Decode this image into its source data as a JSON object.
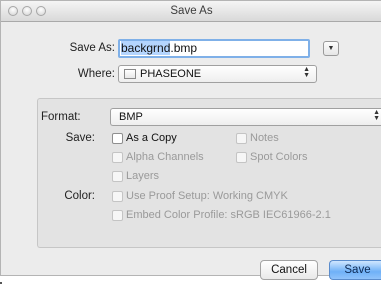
{
  "window": {
    "title": "Save As"
  },
  "form": {
    "save_as_label": "Save As:",
    "filename": "backgrnd.bmp",
    "filename_selected": "backgrnd",
    "filename_ext": ".bmp",
    "where_label": "Where:",
    "where_value": "PHASEONE"
  },
  "options": {
    "format_label": "Format:",
    "format_value": "BMP",
    "save_label": "Save:",
    "color_label": "Color:",
    "as_a_copy": {
      "label": "As a Copy",
      "enabled": true,
      "checked": false
    },
    "notes": {
      "label": "Notes",
      "enabled": false,
      "checked": false
    },
    "alpha_channels": {
      "label": "Alpha Channels",
      "enabled": false,
      "checked": false
    },
    "spot_colors": {
      "label": "Spot Colors",
      "enabled": false,
      "checked": false
    },
    "layers": {
      "label": "Layers",
      "enabled": false,
      "checked": false
    },
    "proof_setup": {
      "label": "Use Proof Setup:  Working CMYK",
      "enabled": false,
      "checked": false
    },
    "embed_profile": {
      "label": "Embed Color Profile:  sRGB IEC61966-2.1",
      "enabled": false,
      "checked": false
    }
  },
  "buttons": {
    "cancel": "Cancel",
    "save": "Save"
  },
  "icons": {
    "close": "traffic-light-close",
    "minimize": "traffic-light-minimize",
    "zoom": "traffic-light-zoom",
    "expand": "disclosure-triangle",
    "folder": "folder-icon",
    "popup_arrows": "up-down-chevrons"
  }
}
